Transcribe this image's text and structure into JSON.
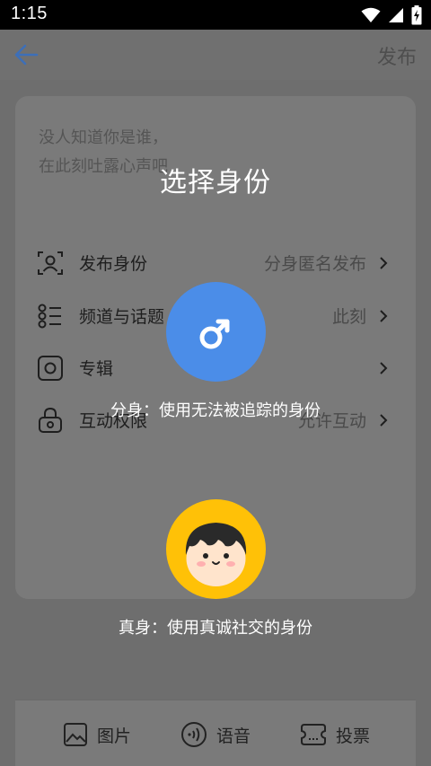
{
  "status_bar": {
    "time": "1:15"
  },
  "header": {
    "back_icon": "arrow-left-icon",
    "publish_label": "发布"
  },
  "post": {
    "placeholder": "没人知道你是谁，\n在此刻吐露心声吧"
  },
  "settings": [
    {
      "icon": "identity-icon",
      "label": "发布身份",
      "value": "分身匿名发布"
    },
    {
      "icon": "channel-list-icon",
      "label": "频道与话题",
      "value": "此刻"
    },
    {
      "icon": "album-icon",
      "label": "专辑",
      "value": ""
    },
    {
      "icon": "lock-icon",
      "label": "互动权限",
      "value": "允许互动"
    }
  ],
  "toolbar": [
    {
      "icon": "image-icon",
      "label": "图片"
    },
    {
      "icon": "voice-icon",
      "label": "语音"
    },
    {
      "icon": "vote-icon",
      "label": "投票"
    }
  ],
  "identity_picker": {
    "title": "选择身份",
    "alter_ego": {
      "symbol": "♂",
      "caption": "分身：使用无法被追踪的身份"
    },
    "real_self": {
      "caption": "真身：使用真诚社交的身份"
    }
  },
  "colors": {
    "alter_ego_bg": "#4b8de8",
    "real_self_bg": "#ffc107",
    "back_arrow": "#3d6fb8"
  }
}
